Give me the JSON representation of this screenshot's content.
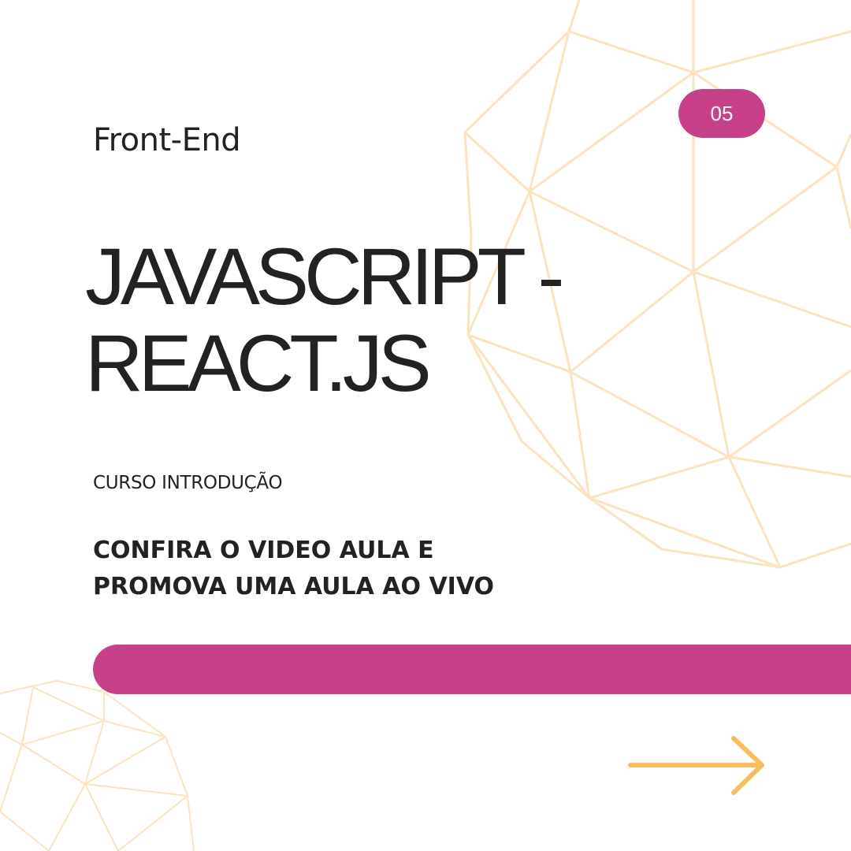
{
  "category": "Front-End",
  "page_number": "05",
  "title_lines": [
    "JAVASCRIPT -",
    "REACT.JS"
  ],
  "subtitle": "CURSO INTRODUÇÃO",
  "cta_lines": [
    "CONFIRA O VIDEO AULA E",
    "PROMOVA UMA AULA AO VIVO"
  ],
  "colors": {
    "accent": "#C6408A",
    "arrow": "#F9BE5A",
    "mesh": "#FBE3BF",
    "text": "#222222",
    "background": "#FFFFFF"
  },
  "icons": {
    "next": "arrow-right-icon",
    "decoration": "geodesic-sphere-mesh"
  }
}
